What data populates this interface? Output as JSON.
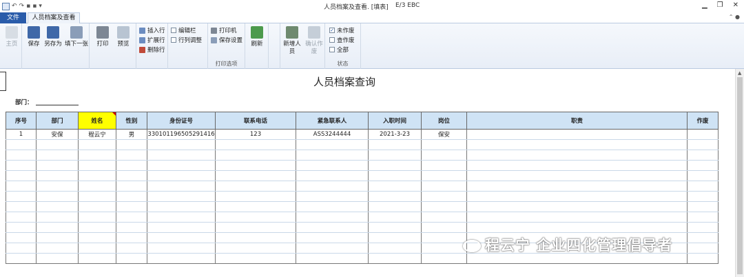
{
  "window": {
    "title": "人员档案及查看. [填表]",
    "app_name": "E/3 EBC",
    "qa_symbols": [
      "↶",
      "↷",
      "▾"
    ]
  },
  "tabs": {
    "file": "文件",
    "active": "人员档案及查看"
  },
  "ribbon": {
    "home": "主页",
    "save": "保存",
    "save_as": "另存为",
    "fill_next": "填下一张",
    "print": "打印",
    "preview": "预览",
    "insert_row": "插入行",
    "expand_row": "扩展行",
    "delete_row": "删除行",
    "edit_bar": "编辑栏",
    "row_col_adjust": "行列调整",
    "printer": "打印机",
    "print_settings": "保存设置",
    "print_group_label": "打印选项",
    "refresh": "刷新",
    "add_person": "新增人员",
    "confirm_void": "确认作废",
    "status_unvoided": "未作废",
    "status_voided": "查作废",
    "status_all": "全部",
    "status_group_label": "状态"
  },
  "document": {
    "title": "人员档案查询",
    "dept_label": "部门："
  },
  "table": {
    "headers": [
      "序号",
      "部门",
      "姓名",
      "性别",
      "身份证号",
      "联系电话",
      "紧急联系人",
      "入职时间",
      "岗位",
      "职责",
      "作废"
    ],
    "rows": [
      [
        "1",
        "安保",
        "程云宁",
        "男",
        "330101196505291416",
        "123",
        "ASS3244444",
        "2021-3-23",
        "保安",
        "",
        ""
      ]
    ],
    "empty_rows": 12
  },
  "watermark": "程云宁 企业四化管理倡导者",
  "colors": {
    "header_bg": "#cfe3f5",
    "highlight": "#ffff00",
    "file_tab": "#2a5caa"
  }
}
